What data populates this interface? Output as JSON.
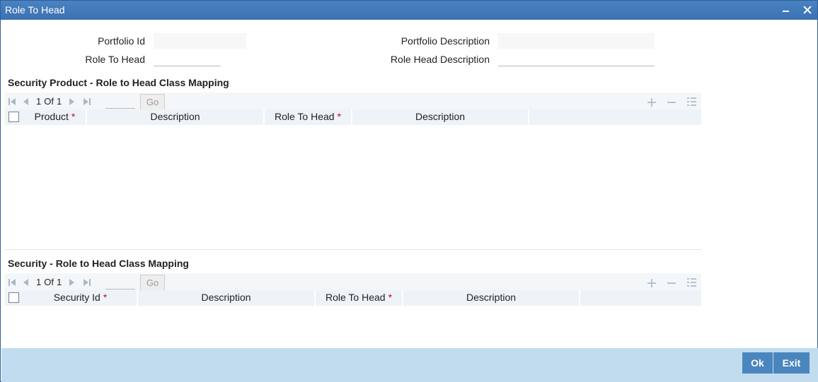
{
  "window": {
    "title": "Role To Head"
  },
  "form": {
    "portfolio_id_label": "Portfolio Id",
    "portfolio_id_value": "",
    "role_to_head_label": "Role To Head",
    "role_to_head_value": "",
    "portfolio_desc_label": "Portfolio Description",
    "portfolio_desc_value": "",
    "role_head_desc_label": "Role Head Description",
    "role_head_desc_value": ""
  },
  "product_grid": {
    "title": "Security Product - Role to Head Class Mapping",
    "page_current": "1",
    "page_of": "Of",
    "page_total": "1",
    "go_label": "Go",
    "columns": [
      "Product",
      "Description",
      "Role To Head",
      "Description"
    ],
    "required_marker": "*"
  },
  "security_grid": {
    "title": "Security - Role to Head Class Mapping",
    "page_current": "1",
    "page_of": "Of",
    "page_total": "1",
    "go_label": "Go",
    "columns": [
      "Security Id",
      "Description",
      "Role To Head",
      "Description"
    ],
    "required_marker": "*"
  },
  "footer": {
    "ok_label": "Ok",
    "exit_label": "Exit"
  },
  "colors": {
    "titlebar": "#3b71b2",
    "footer": "#c2dcef",
    "button": "#4a86be",
    "required": "#d0021b"
  }
}
